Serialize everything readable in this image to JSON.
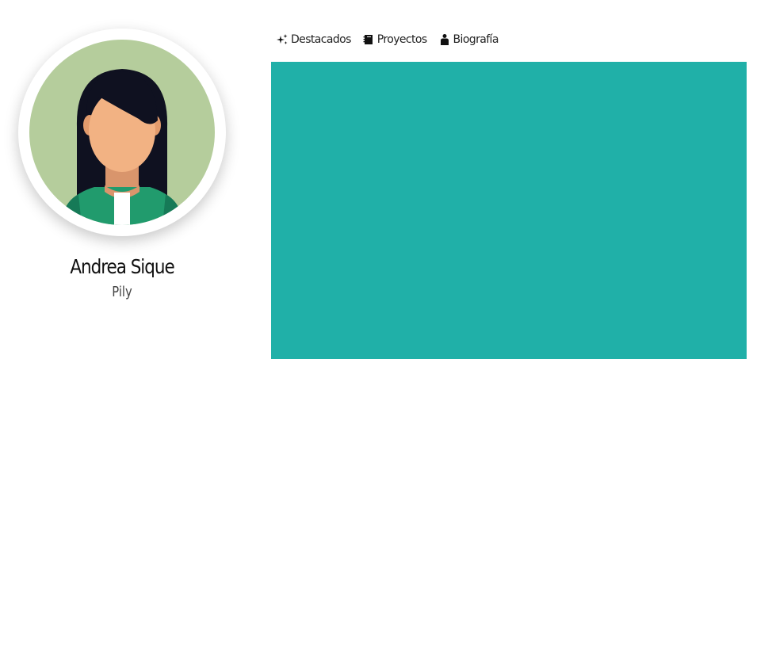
{
  "profile": {
    "name": "Andrea Sique",
    "nickname": "Pily"
  },
  "tabs": [
    {
      "label": "Destacados",
      "icon": "sparkles-icon"
    },
    {
      "label": "Proyectos",
      "icon": "notebook-icon"
    },
    {
      "label": "Biografía",
      "icon": "person-icon"
    }
  ],
  "colors": {
    "panel": "#20b0a8",
    "avatar_background": "#b5cd9c",
    "jacket": "#219b6d",
    "hair": "#0f1120",
    "skin": "#f2b283"
  }
}
